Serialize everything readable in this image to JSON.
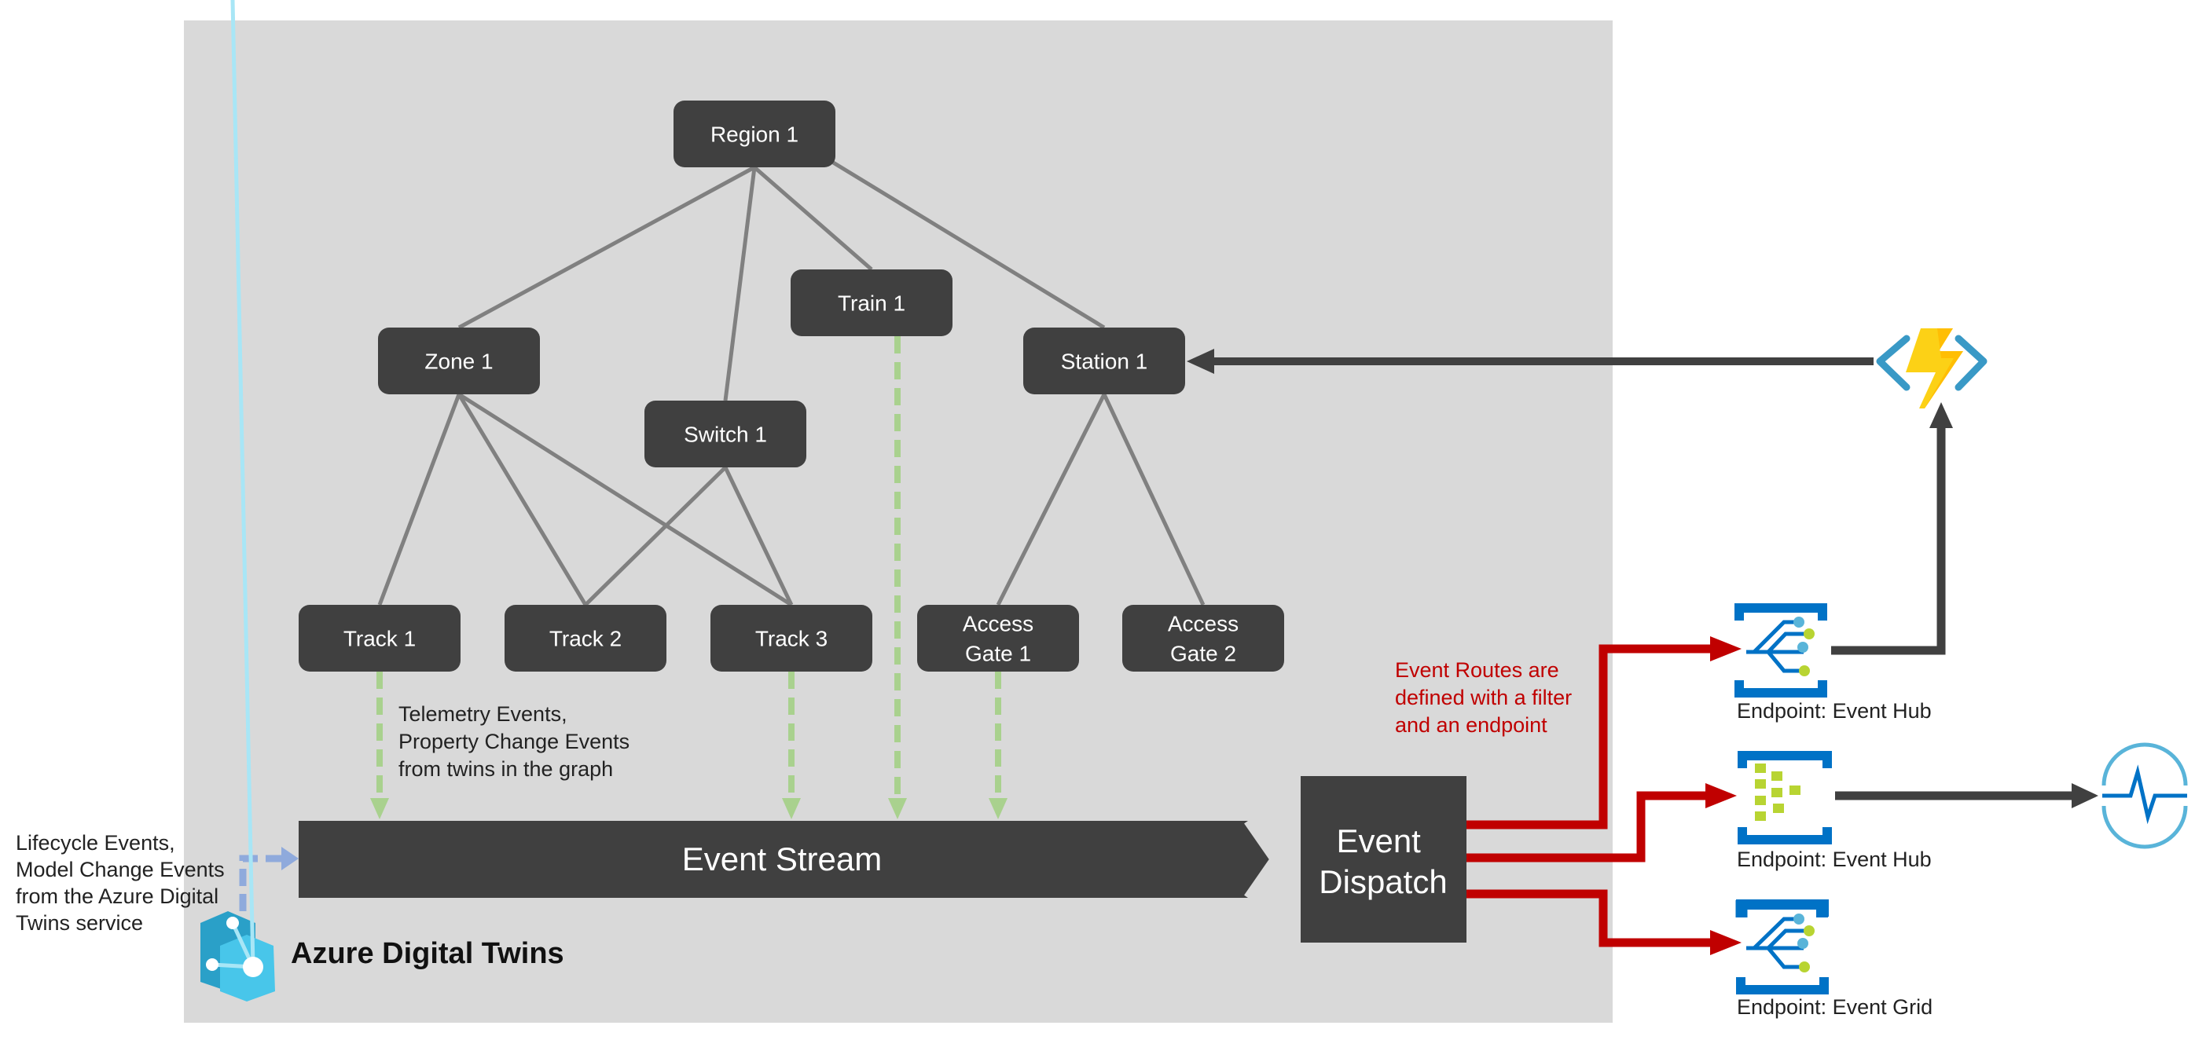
{
  "colors": {
    "panel": "#d9d9d9",
    "node": "#404040",
    "edge": "#808080",
    "telemetry_arrow": "#a9d18e",
    "lifecycle_arrow": "#8faadc",
    "route_arrow": "#c00000",
    "output_arrow": "#404040",
    "endpoint_blue": "#0072c6",
    "endpoint_green": "#b8d432",
    "endpoint_lightblue": "#59b4d9",
    "annotation_red": "#c00000"
  },
  "graph": {
    "nodes": [
      {
        "id": "region1",
        "label": [
          "Region 1"
        ]
      },
      {
        "id": "zone1",
        "label": [
          "Zone 1"
        ]
      },
      {
        "id": "switch1",
        "label": [
          "Switch 1"
        ]
      },
      {
        "id": "train1",
        "label": [
          "Train 1"
        ]
      },
      {
        "id": "station1",
        "label": [
          "Station 1"
        ]
      },
      {
        "id": "track1",
        "label": [
          "Track 1"
        ]
      },
      {
        "id": "track2",
        "label": [
          "Track 2"
        ]
      },
      {
        "id": "track3",
        "label": [
          "Track 3"
        ]
      },
      {
        "id": "gate1",
        "label": [
          "Access",
          "Gate 1"
        ]
      },
      {
        "id": "gate2",
        "label": [
          "Access",
          "Gate 2"
        ]
      }
    ],
    "edges": [
      [
        "region1",
        "zone1"
      ],
      [
        "region1",
        "switch1"
      ],
      [
        "region1",
        "train1"
      ],
      [
        "region1",
        "station1"
      ],
      [
        "zone1",
        "track1"
      ],
      [
        "zone1",
        "track2"
      ],
      [
        "zone1",
        "track3"
      ],
      [
        "switch1",
        "track2"
      ],
      [
        "switch1",
        "track3"
      ],
      [
        "station1",
        "gate1"
      ],
      [
        "station1",
        "gate2"
      ]
    ],
    "telemetry_sources": [
      "track1",
      "track3",
      "train1",
      "gate1"
    ]
  },
  "annotations": {
    "telemetry": [
      "Telemetry Events,",
      "Property Change Events",
      "from twins in the graph"
    ],
    "lifecycle": [
      "Lifecycle Events,",
      "Model Change Events",
      "from the Azure Digital",
      "Twins service"
    ],
    "routes": [
      "Event Routes are",
      "defined with a filter",
      "and an endpoint"
    ]
  },
  "event_stream": {
    "label": "Event Stream"
  },
  "event_dispatch": {
    "label": [
      "Event",
      "Dispatch"
    ]
  },
  "service": {
    "name": "Azure Digital Twins",
    "icon": "azure-digital-twins-icon"
  },
  "endpoints": [
    {
      "label": "Endpoint: Event Hub",
      "icon": "event-hub-icon",
      "target": "azure-function-icon"
    },
    {
      "label": "Endpoint: Event Hub",
      "icon": "event-hub-queue-icon",
      "target": "time-series-insights-icon"
    },
    {
      "label": "Endpoint: Event Grid",
      "icon": "event-grid-icon",
      "target": null
    }
  ]
}
